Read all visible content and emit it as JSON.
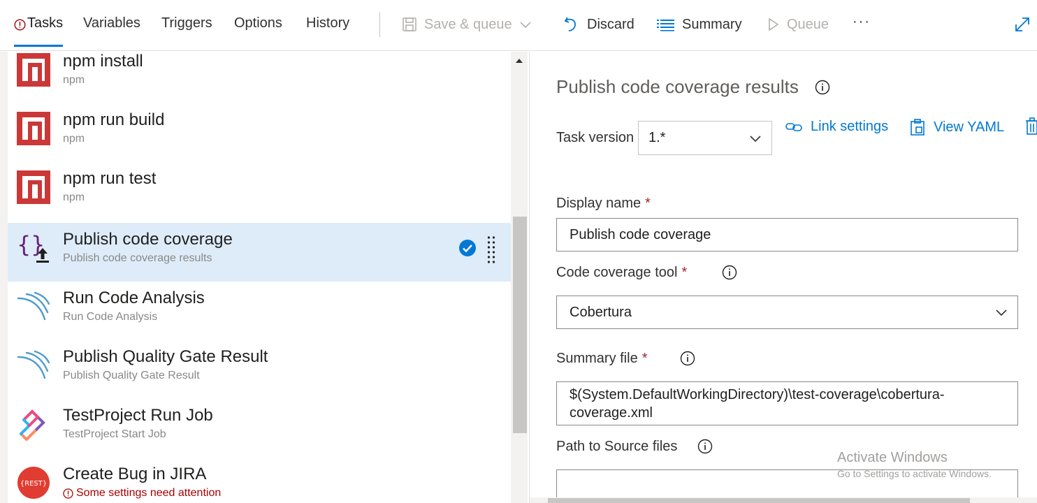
{
  "tabs": [
    {
      "label": "Tasks",
      "active": true,
      "has_error": true
    },
    {
      "label": "Variables"
    },
    {
      "label": "Triggers"
    },
    {
      "label": "Options"
    },
    {
      "label": "History"
    }
  ],
  "toolbar": {
    "save_queue": "Save & queue",
    "discard": "Discard",
    "summary": "Summary",
    "queue": "Queue",
    "more": "···"
  },
  "tasks": [
    {
      "title": "npm install",
      "subtitle": "npm",
      "icon": "npm-icon"
    },
    {
      "title": "npm run build",
      "subtitle": "npm",
      "icon": "npm-icon"
    },
    {
      "title": "npm run test",
      "subtitle": "npm",
      "icon": "npm-icon"
    },
    {
      "title": "Publish code coverage",
      "subtitle": "Publish code coverage results",
      "icon": "publish-coverage-icon",
      "selected": true
    },
    {
      "title": "Run Code Analysis",
      "subtitle": "Run Code Analysis",
      "icon": "sonarqube-icon"
    },
    {
      "title": "Publish Quality Gate Result",
      "subtitle": "Publish Quality Gate Result",
      "icon": "sonarqube-icon"
    },
    {
      "title": "TestProject Run Job",
      "subtitle": "TestProject Start Job",
      "icon": "testproject-icon"
    },
    {
      "title": "Create Bug in JIRA",
      "subtitle": "Some settings need attention",
      "icon": "rest-icon",
      "subtitle_error": true
    }
  ],
  "details": {
    "title": "Publish code coverage results",
    "task_version_label": "Task version",
    "task_version_value": "1.*",
    "link_settings": "Link settings",
    "view_yaml": "View YAML",
    "display_name_label": "Display name",
    "display_name_value": "Publish code coverage",
    "code_coverage_tool_label": "Code coverage tool",
    "code_coverage_tool_value": "Cobertura",
    "summary_file_label": "Summary file",
    "summary_file_value_line1": "$(System.DefaultWorkingDirectory)\\test-coverage\\cobertura-",
    "summary_file_value_line2": "coverage.xml",
    "path_to_source_label": "Path to Source files",
    "required_mark": "*"
  },
  "watermark": {
    "line1": "Activate Windows",
    "line2": "Go to Settings to activate Windows."
  },
  "colors": {
    "accent": "#0078d4",
    "selected_row": "#deecf9",
    "npm": "#cb3837",
    "error": "#a80000"
  }
}
